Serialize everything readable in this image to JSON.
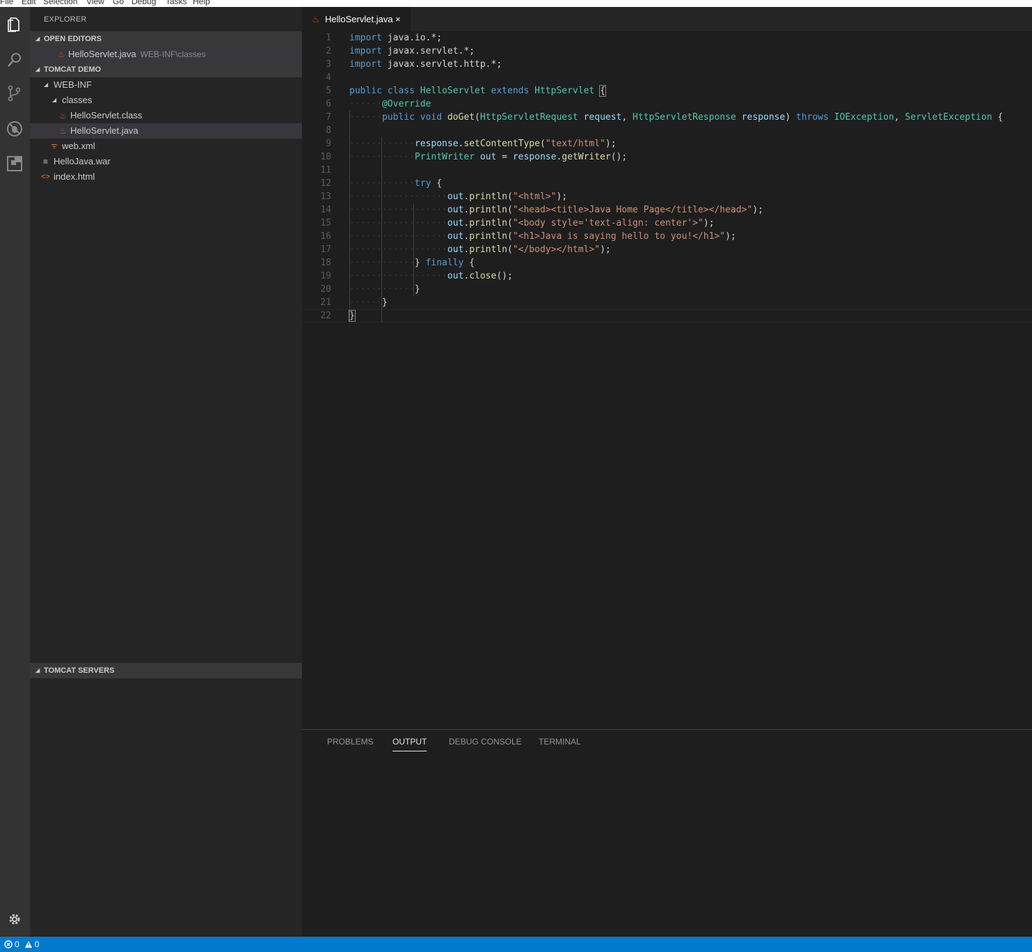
{
  "menu": [
    "File",
    "Edit",
    "Selection",
    "View",
    "Go",
    "Debug",
    "Tasks",
    "Help"
  ],
  "activity": {
    "icons": [
      "files-icon",
      "search-icon",
      "source-control-icon",
      "debug-icon",
      "extensions-icon"
    ],
    "settings": "gear-icon"
  },
  "sidebar": {
    "title": "EXPLORER",
    "open_editors": {
      "header": "OPEN EDITORS",
      "items": [
        {
          "name": "HelloServlet.java",
          "desc": "WEB-INF\\classes"
        }
      ]
    },
    "tomcat_demo": {
      "header": "TOMCAT DEMO",
      "tree": {
        "web_inf": "WEB-INF",
        "classes": "classes",
        "hello_class": "HelloServlet.class",
        "hello_java": "HelloServlet.java",
        "web_xml": "web.xml",
        "hello_war": "HelloJava.war",
        "index_html": "index.html"
      }
    },
    "tomcat_servers": {
      "header": "TOMCAT SERVERS"
    }
  },
  "editor": {
    "tab": {
      "label": "HelloServlet.java",
      "close": "×"
    },
    "line_numbers": [
      "1",
      "2",
      "3",
      "4",
      "5",
      "6",
      "7",
      "8",
      "9",
      "10",
      "11",
      "12",
      "13",
      "14",
      "15",
      "16",
      "17",
      "18",
      "19",
      "20",
      "21",
      "22"
    ]
  },
  "code": {
    "l1": {
      "kw": "import",
      "rest": " java.io.*;"
    },
    "l2": {
      "kw": "import",
      "rest": " javax.servlet.*;"
    },
    "l3": {
      "kw": "import",
      "rest": " javax.servlet.http.*;"
    },
    "l5": {
      "kw1": "public",
      "kw2": "class",
      "cls": "HelloServlet",
      "kw3": "extends",
      "parent": "HttpServlet",
      "brace": "{"
    },
    "l6": {
      "ann": "@Override"
    },
    "l7": {
      "kw1": "public",
      "kw2": "void",
      "fn": "doGet",
      "t1": "HttpServletRequest",
      "p1": "request",
      "t2": "HttpServletResponse",
      "p2": "response",
      "kw3": "throws",
      "e1": "IOException",
      "e2": "ServletException"
    },
    "l9": {
      "obj": "response",
      "fn": "setContentType",
      "str": "\"text/html\""
    },
    "l10": {
      "type": "PrintWriter",
      "var": "out",
      "obj": "response",
      "fn": "getWriter"
    },
    "l12": {
      "kw": "try",
      "brace": "{"
    },
    "l13": {
      "obj": "out",
      "fn": "println",
      "str": "\"<html>\""
    },
    "l14": {
      "obj": "out",
      "fn": "println",
      "str": "\"<head><title>Java Home Page</title></head>\""
    },
    "l15": {
      "obj": "out",
      "fn": "println",
      "str": "\"<body style='text-align: center'>\""
    },
    "l16": {
      "obj": "out",
      "fn": "println",
      "str": "\"<h1>Java is saying hello to you!</h1>\""
    },
    "l17": {
      "obj": "out",
      "fn": "println",
      "str": "\"</body></html>\""
    },
    "l18": {
      "close": "}",
      "kw": "finally",
      "open": "{"
    },
    "l19": {
      "obj": "out",
      "fn": "close"
    },
    "l20": {
      "close": "}"
    },
    "l21": {
      "close": "}"
    },
    "l22": {
      "close": "}"
    }
  },
  "panel": {
    "tabs": [
      "PROBLEMS",
      "OUTPUT",
      "DEBUG CONSOLE",
      "TERMINAL"
    ],
    "active": "OUTPUT"
  },
  "statusbar": {
    "errors": "0",
    "warnings": "0"
  },
  "colors": {
    "accent": "#007acc",
    "java_icon": "#d44e3c",
    "xml_icon": "#e37933",
    "html_icon": "#e37933"
  }
}
